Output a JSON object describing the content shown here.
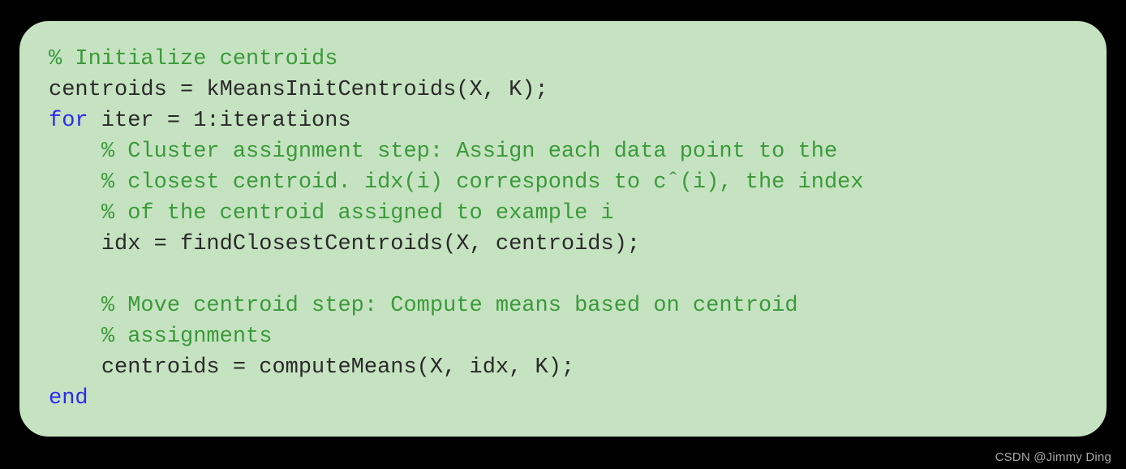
{
  "code": {
    "lines": [
      {
        "indent": 0,
        "spans": [
          {
            "cls": "c",
            "t": "% Initialize centroids"
          }
        ]
      },
      {
        "indent": 0,
        "spans": [
          {
            "cls": "p",
            "t": "centroids = kMeansInitCentroids(X, K);"
          }
        ]
      },
      {
        "indent": 0,
        "spans": [
          {
            "cls": "k",
            "t": "for"
          },
          {
            "cls": "p",
            "t": " iter = 1:iterations"
          }
        ]
      },
      {
        "indent": 1,
        "spans": [
          {
            "cls": "c",
            "t": "% Cluster assignment step: Assign each data point to the"
          }
        ]
      },
      {
        "indent": 1,
        "spans": [
          {
            "cls": "c",
            "t": "% closest centroid. idx(i) corresponds to cˆ(i), the index"
          }
        ]
      },
      {
        "indent": 1,
        "spans": [
          {
            "cls": "c",
            "t": "% of the centroid assigned to example i"
          }
        ]
      },
      {
        "indent": 1,
        "spans": [
          {
            "cls": "p",
            "t": "idx = findClosestCentroids(X, centroids);"
          }
        ]
      },
      {
        "indent": 0,
        "spans": [
          {
            "cls": "p",
            "t": ""
          }
        ]
      },
      {
        "indent": 1,
        "spans": [
          {
            "cls": "c",
            "t": "% Move centroid step: Compute means based on centroid"
          }
        ]
      },
      {
        "indent": 1,
        "spans": [
          {
            "cls": "c",
            "t": "% assignments"
          }
        ]
      },
      {
        "indent": 1,
        "spans": [
          {
            "cls": "p",
            "t": "centroids = computeMeans(X, idx, K);"
          }
        ]
      },
      {
        "indent": 0,
        "spans": [
          {
            "cls": "k",
            "t": "end"
          }
        ]
      }
    ],
    "indent_unit": "    "
  },
  "watermark": "CSDN @Jimmy Ding"
}
